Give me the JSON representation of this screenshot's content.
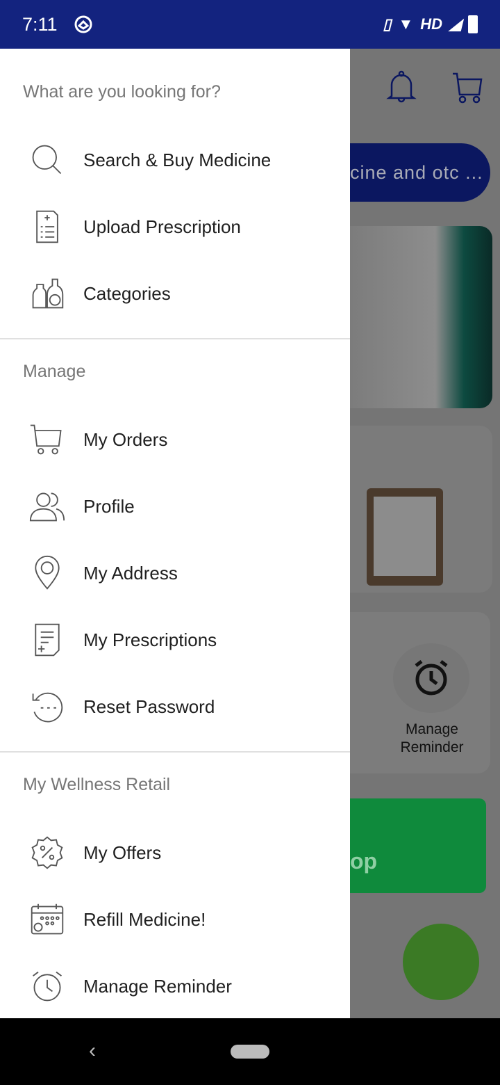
{
  "status_bar": {
    "time": "7:11",
    "network": "HD"
  },
  "background": {
    "search_placeholder": "cine and otc ...",
    "reminder_label": "Manage Reminder",
    "whatsapp_text": "op"
  },
  "drawer": {
    "sections": [
      {
        "title": "What are you looking for?",
        "items": [
          {
            "label": "Search & Buy Medicine",
            "icon": "search-icon"
          },
          {
            "label": "Upload Prescription",
            "icon": "prescription-icon"
          },
          {
            "label": "Categories",
            "icon": "categories-icon"
          }
        ]
      },
      {
        "title": "Manage",
        "items": [
          {
            "label": "My Orders",
            "icon": "cart-icon"
          },
          {
            "label": "Profile",
            "icon": "profile-icon"
          },
          {
            "label": "My Address",
            "icon": "location-icon"
          },
          {
            "label": "My Prescriptions",
            "icon": "document-icon"
          },
          {
            "label": "Reset Password",
            "icon": "reset-password-icon"
          }
        ]
      },
      {
        "title": "My Wellness Retail",
        "items": [
          {
            "label": "My Offers",
            "icon": "offer-icon"
          },
          {
            "label": "Refill Medicine!",
            "icon": "calendar-icon"
          },
          {
            "label": "Manage Reminder",
            "icon": "alarm-icon"
          }
        ]
      }
    ]
  },
  "colors": {
    "status_bar": "#13237f",
    "accent": "#0b1760",
    "whatsapp": "#0f8a3c"
  }
}
